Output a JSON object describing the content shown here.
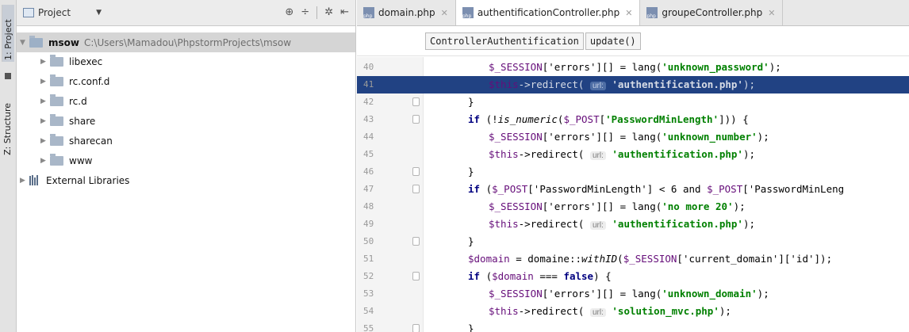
{
  "toolstrip": {
    "project_tab": "1: Project",
    "structure_tab": "Z: Structure"
  },
  "project_panel": {
    "title": "Project",
    "tree": [
      {
        "name": "msow",
        "path": "C:\\Users\\Mamadou\\PhpstormProjects\\msow",
        "level": 0,
        "expanded": true,
        "bold": true
      },
      {
        "name": "libexec",
        "level": 1
      },
      {
        "name": "rc.conf.d",
        "level": 1
      },
      {
        "name": "rc.d",
        "level": 1
      },
      {
        "name": "share",
        "level": 1
      },
      {
        "name": "sharecan",
        "level": 1
      },
      {
        "name": "www",
        "level": 1
      },
      {
        "name": "External Libraries",
        "level": 0,
        "library": true
      }
    ]
  },
  "editor": {
    "tabs": [
      {
        "label": "domain.php",
        "active": false
      },
      {
        "label": "authentificationController.php",
        "active": true
      },
      {
        "label": "groupeController.php",
        "active": false
      }
    ],
    "breadcrumb": [
      "ControllerAuthentification",
      "update()"
    ],
    "highlight_line": 41,
    "lines": [
      {
        "n": "40",
        "indent": 3,
        "parts": [
          [
            "v",
            "$_SESSION"
          ],
          [
            "t",
            "['errors'][] = lang("
          ],
          [
            "s",
            "'unknown_password'"
          ],
          [
            "t",
            ");"
          ]
        ]
      },
      {
        "n": "41",
        "indent": 3,
        "parts": [
          [
            "v",
            "$this"
          ],
          [
            "t",
            "->redirect( "
          ],
          [
            "h",
            "url:"
          ],
          [
            "t",
            " "
          ],
          [
            "s",
            "'authentification.php'"
          ],
          [
            "t",
            ");"
          ]
        ]
      },
      {
        "n": "42",
        "indent": 2,
        "parts": [
          [
            "t",
            "}"
          ]
        ]
      },
      {
        "n": "43",
        "indent": 2,
        "parts": [
          [
            "k",
            "if"
          ],
          [
            "t",
            " (!"
          ],
          [
            "i",
            "is_numeric"
          ],
          [
            "t",
            "("
          ],
          [
            "v",
            "$_POST"
          ],
          [
            "t",
            "["
          ],
          [
            "s",
            "'PasswordMinLength'"
          ],
          [
            "t",
            "])) {"
          ]
        ]
      },
      {
        "n": "44",
        "indent": 3,
        "parts": [
          [
            "v",
            "$_SESSION"
          ],
          [
            "t",
            "['errors'][] = lang("
          ],
          [
            "s",
            "'unknown_number'"
          ],
          [
            "t",
            ");"
          ]
        ]
      },
      {
        "n": "45",
        "indent": 3,
        "parts": [
          [
            "v",
            "$this"
          ],
          [
            "t",
            "->redirect( "
          ],
          [
            "h",
            "url:"
          ],
          [
            "t",
            " "
          ],
          [
            "s",
            "'authentification.php'"
          ],
          [
            "t",
            ");"
          ]
        ]
      },
      {
        "n": "46",
        "indent": 2,
        "parts": [
          [
            "t",
            "}"
          ]
        ]
      },
      {
        "n": "47",
        "indent": 2,
        "parts": [
          [
            "k",
            "if"
          ],
          [
            "t",
            " ("
          ],
          [
            "v",
            "$_POST"
          ],
          [
            "t",
            "['PasswordMinLength'] < 6 and "
          ],
          [
            "v",
            "$_POST"
          ],
          [
            "t",
            "['PasswordMinLeng"
          ]
        ]
      },
      {
        "n": "48",
        "indent": 3,
        "parts": [
          [
            "v",
            "$_SESSION"
          ],
          [
            "t",
            "['errors'][] = lang("
          ],
          [
            "s",
            "'no more 20'"
          ],
          [
            "t",
            ");"
          ]
        ]
      },
      {
        "n": "49",
        "indent": 3,
        "parts": [
          [
            "v",
            "$this"
          ],
          [
            "t",
            "->redirect( "
          ],
          [
            "h",
            "url:"
          ],
          [
            "t",
            " "
          ],
          [
            "s",
            "'authentification.php'"
          ],
          [
            "t",
            ");"
          ]
        ]
      },
      {
        "n": "50",
        "indent": 2,
        "parts": [
          [
            "t",
            "}"
          ]
        ]
      },
      {
        "n": "51",
        "indent": 2,
        "parts": [
          [
            "v",
            "$domain"
          ],
          [
            "t",
            " = domaine::"
          ],
          [
            "i",
            "withID"
          ],
          [
            "t",
            "("
          ],
          [
            "v",
            "$_SESSION"
          ],
          [
            "t",
            "['current_domain']['id']);"
          ]
        ]
      },
      {
        "n": "52",
        "indent": 2,
        "parts": [
          [
            "k",
            "if"
          ],
          [
            "t",
            " ("
          ],
          [
            "v",
            "$domain"
          ],
          [
            "t",
            " === "
          ],
          [
            "k",
            "false"
          ],
          [
            "t",
            ") {"
          ]
        ]
      },
      {
        "n": "53",
        "indent": 3,
        "parts": [
          [
            "v",
            "$_SESSION"
          ],
          [
            "t",
            "['errors'][] = lang("
          ],
          [
            "s",
            "'unknown_domain'"
          ],
          [
            "t",
            ");"
          ]
        ]
      },
      {
        "n": "54",
        "indent": 3,
        "parts": [
          [
            "v",
            "$this"
          ],
          [
            "t",
            "->redirect( "
          ],
          [
            "h",
            "url:"
          ],
          [
            "t",
            " "
          ],
          [
            "s",
            "'solution_mvc.php'"
          ],
          [
            "t",
            ");"
          ]
        ]
      },
      {
        "n": "55",
        "indent": 2,
        "parts": [
          [
            "t",
            "}"
          ]
        ]
      }
    ]
  }
}
